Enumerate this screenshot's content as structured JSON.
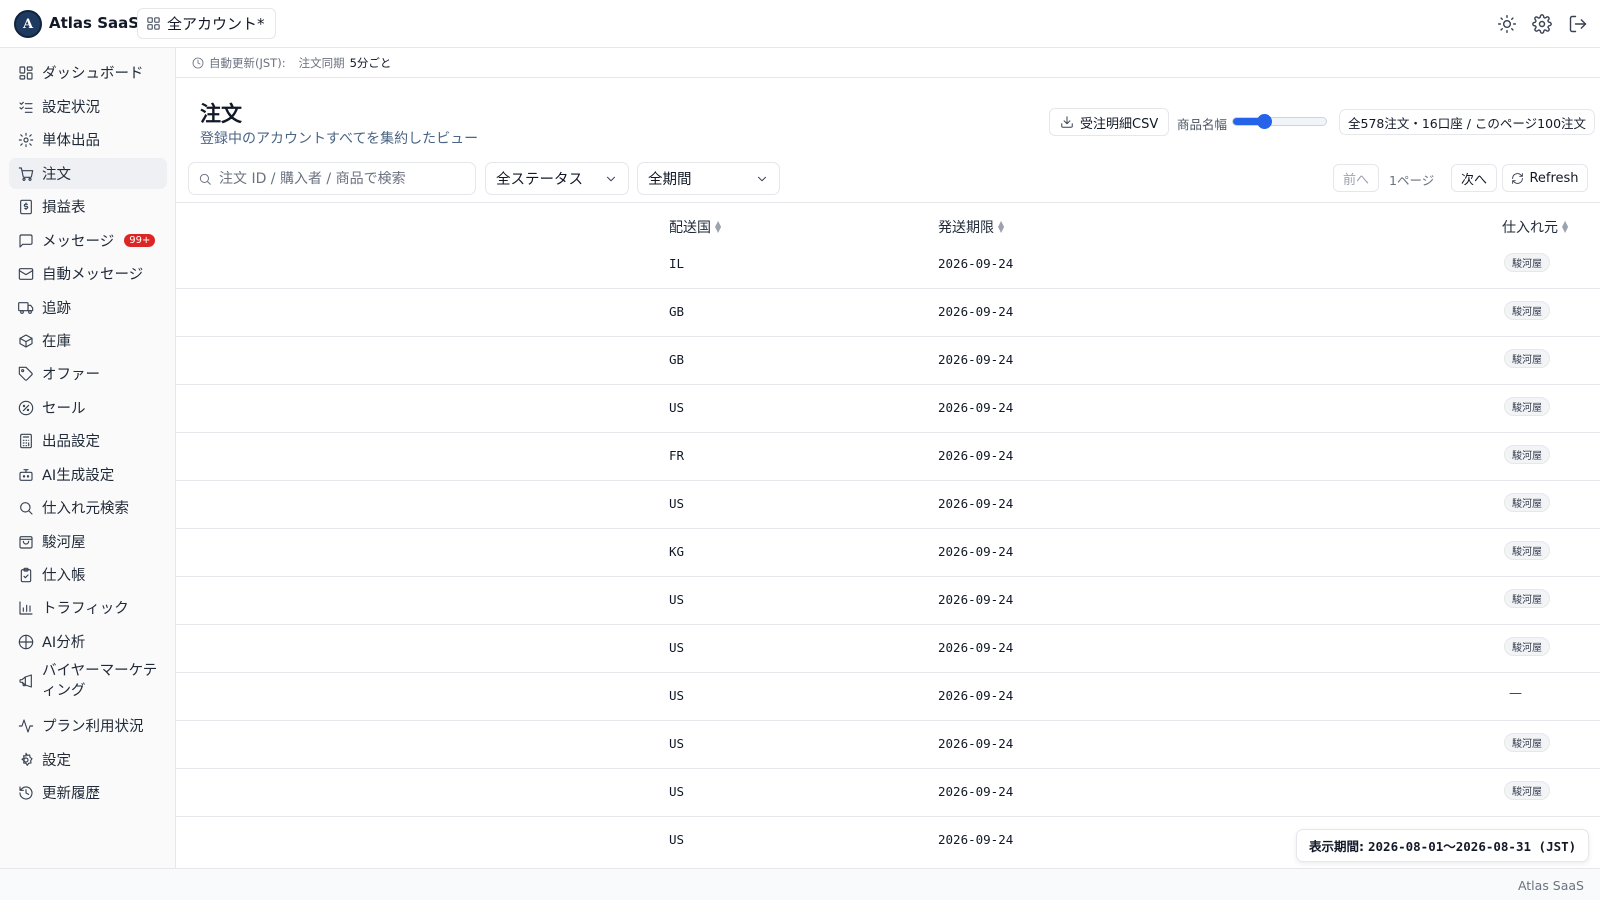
{
  "app": {
    "brand": "Atlas SaaS",
    "logo_letter": "A",
    "account_selector": "全アカウント*"
  },
  "sidebar": {
    "items": [
      {
        "label": "ダッシュボード",
        "icon": "dashboard-icon"
      },
      {
        "label": "設定状況",
        "icon": "checklist-icon"
      },
      {
        "label": "単体出品",
        "icon": "gear-icon"
      },
      {
        "label": "注文",
        "icon": "cart-icon",
        "active": true
      },
      {
        "label": "損益表",
        "icon": "receipt-icon"
      },
      {
        "label": "メッセージ",
        "icon": "message-icon",
        "badge": "99+"
      },
      {
        "label": "自動メッセージ",
        "icon": "mail-icon"
      },
      {
        "label": "追跡",
        "icon": "truck-icon"
      },
      {
        "label": "在庫",
        "icon": "box-icon"
      },
      {
        "label": "オファー",
        "icon": "tag-icon"
      },
      {
        "label": "セール",
        "icon": "sale-icon"
      },
      {
        "label": "出品設定",
        "icon": "calculator-icon"
      },
      {
        "label": "AI生成設定",
        "icon": "bot-icon"
      },
      {
        "label": "仕入れ元検索",
        "icon": "search-icon"
      },
      {
        "label": "駿河屋",
        "icon": "shopping-bag-icon"
      },
      {
        "label": "仕入帳",
        "icon": "clipboard-icon"
      },
      {
        "label": "トラフィック",
        "icon": "bar-chart-icon"
      },
      {
        "label": "AI分析",
        "icon": "globe-icon"
      },
      {
        "label": "バイヤーマーケティング",
        "icon": "megaphone-icon"
      },
      {
        "label": "プラン利用状況",
        "icon": "activity-icon"
      },
      {
        "label": "設定",
        "icon": "settings-icon"
      },
      {
        "label": "更新履歴",
        "icon": "history-icon"
      }
    ]
  },
  "strip": {
    "auto_update_label": "自動更新(JST):",
    "sync_label": "注文同期",
    "sync_value": "5分ごと"
  },
  "header": {
    "title": "注文",
    "subtitle": "登録中のアカウントすべてを集約したビュー",
    "csv_button": "受注明細CSV",
    "width_label": "商品名幅",
    "width_slider_fraction": 0.33,
    "count_summary": "全578注文・16口座 / このページ100注文"
  },
  "filters": {
    "search_placeholder": "注文 ID / 購入者 / 商品で検索",
    "status": "全ステータス",
    "period": "全期間"
  },
  "pager": {
    "prev": "前へ",
    "info": "1ページ",
    "next": "次へ",
    "refresh": "Refresh"
  },
  "table": {
    "columns": [
      "配送国",
      "発送期限",
      "仕入れ元"
    ],
    "rows": [
      {
        "country": "IL",
        "deadline": "2026-09-24",
        "source": "駿河屋"
      },
      {
        "country": "GB",
        "deadline": "2026-09-24",
        "source": "駿河屋"
      },
      {
        "country": "GB",
        "deadline": "2026-09-24",
        "source": "駿河屋"
      },
      {
        "country": "US",
        "deadline": "2026-09-24",
        "source": "駿河屋"
      },
      {
        "country": "FR",
        "deadline": "2026-09-24",
        "source": "駿河屋"
      },
      {
        "country": "US",
        "deadline": "2026-09-24",
        "source": "駿河屋"
      },
      {
        "country": "KG",
        "deadline": "2026-09-24",
        "source": "駿河屋"
      },
      {
        "country": "US",
        "deadline": "2026-09-24",
        "source": "駿河屋"
      },
      {
        "country": "US",
        "deadline": "2026-09-24",
        "source": "駿河屋"
      },
      {
        "country": "US",
        "deadline": "2026-09-24",
        "source": "—"
      },
      {
        "country": "US",
        "deadline": "2026-09-24",
        "source": "駿河屋"
      },
      {
        "country": "US",
        "deadline": "2026-09-24",
        "source": "駿河屋"
      },
      {
        "country": "US",
        "deadline": "2026-09-24",
        "source": ""
      }
    ]
  },
  "period_popup": {
    "label": "表示期間:",
    "value": "2026-08-01〜2026-08-31 (JST)"
  },
  "footer": {
    "text": "Atlas SaaS"
  },
  "colors": {
    "accent": "#2563eb",
    "badge": "#dc2626",
    "logo": "#1e3a5f"
  }
}
